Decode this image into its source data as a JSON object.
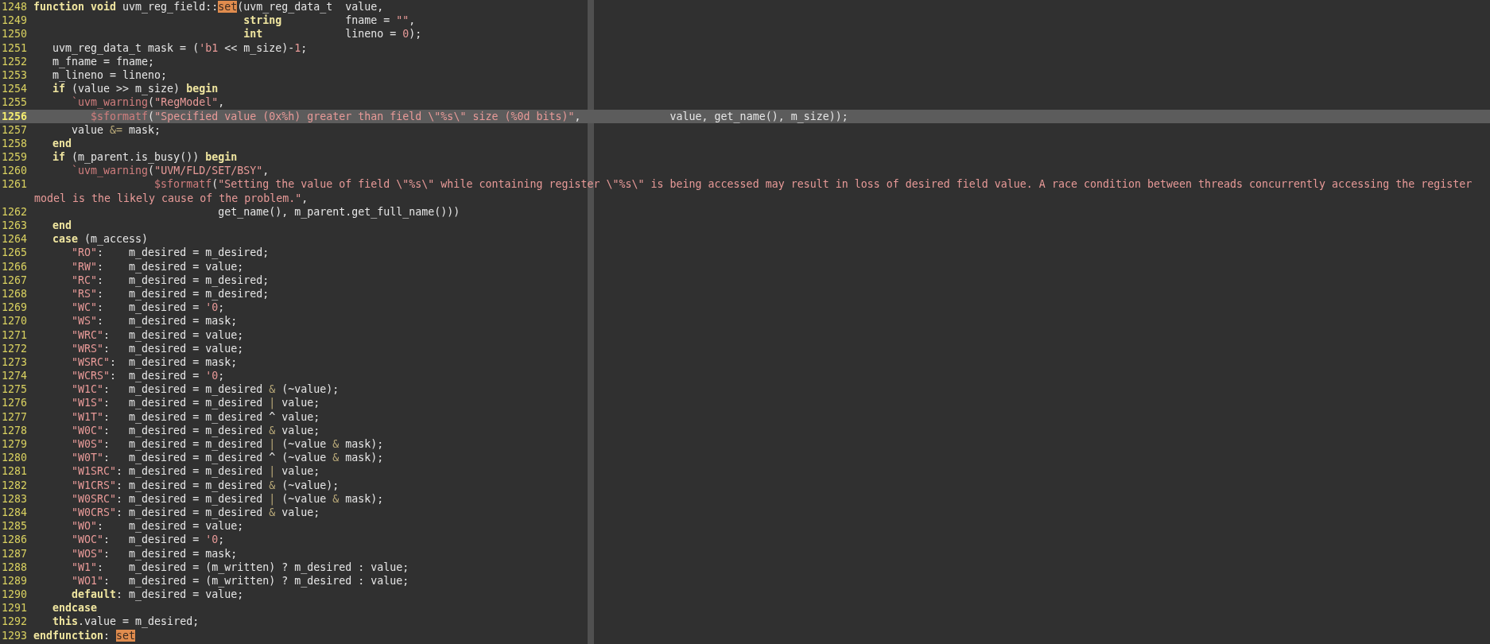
{
  "editor": {
    "lines": [
      {
        "kind": "code",
        "number": "1248",
        "current": false,
        "tokens": [
          {
            "kind": "keyword",
            "text": "function void"
          },
          {
            "kind": "plain",
            "text": " uvm_reg_field::"
          },
          {
            "kind": "match",
            "text": "set"
          },
          {
            "kind": "plain",
            "text": "(uvm_reg_data_t  value,"
          }
        ]
      },
      {
        "kind": "code",
        "number": "1249",
        "current": false,
        "tokens": [
          {
            "kind": "keyword",
            "text": "                                 string"
          },
          {
            "kind": "plain",
            "text": "          fname = "
          },
          {
            "kind": "string",
            "text": "\"\""
          },
          {
            "kind": "plain",
            "text": ","
          }
        ]
      },
      {
        "kind": "code",
        "number": "1250",
        "current": false,
        "tokens": [
          {
            "kind": "keyword",
            "text": "                                 int"
          },
          {
            "kind": "plain",
            "text": "             lineno = "
          },
          {
            "kind": "number",
            "text": "0"
          },
          {
            "kind": "plain",
            "text": ");"
          }
        ]
      },
      {
        "kind": "code",
        "number": "1251",
        "current": false,
        "tokens": [
          {
            "kind": "plain",
            "text": "   uvm_reg_data_t mask = ("
          },
          {
            "kind": "number",
            "text": "'b1"
          },
          {
            "kind": "plain",
            "text": " << m_size)-"
          },
          {
            "kind": "number",
            "text": "1"
          },
          {
            "kind": "plain",
            "text": ";"
          }
        ]
      },
      {
        "kind": "code",
        "number": "1252",
        "current": false,
        "tokens": [
          {
            "kind": "plain",
            "text": "   m_fname = fname;"
          }
        ]
      },
      {
        "kind": "code",
        "number": "1253",
        "current": false,
        "tokens": [
          {
            "kind": "plain",
            "text": "   m_lineno = lineno;"
          }
        ]
      },
      {
        "kind": "code",
        "number": "1254",
        "current": false,
        "tokens": [
          {
            "kind": "keyword",
            "text": "   if"
          },
          {
            "kind": "plain",
            "text": " (value >> m_size) "
          },
          {
            "kind": "keyword",
            "text": "begin"
          }
        ]
      },
      {
        "kind": "code",
        "number": "1255",
        "current": false,
        "tokens": [
          {
            "kind": "macro",
            "text": "      `uvm_warning"
          },
          {
            "kind": "plain",
            "text": "("
          },
          {
            "kind": "string",
            "text": "\"RegModel\""
          },
          {
            "kind": "plain",
            "text": ","
          }
        ]
      },
      {
        "kind": "code",
        "number": "1256",
        "current": true,
        "tokens": [
          {
            "kind": "macro",
            "text": "         $sformatf"
          },
          {
            "kind": "plain",
            "text": "("
          },
          {
            "kind": "string",
            "text": "\"Specified value (0x%h) greater than field \\\"%s\\\" size (%0d bits)\""
          },
          {
            "kind": "plain",
            "text": ",              value, get_name(), m_size));"
          }
        ]
      },
      {
        "kind": "code",
        "number": "1257",
        "current": false,
        "tokens": [
          {
            "kind": "plain",
            "text": "      value "
          },
          {
            "kind": "operator",
            "text": "&="
          },
          {
            "kind": "plain",
            "text": " mask;"
          }
        ]
      },
      {
        "kind": "code",
        "number": "1258",
        "current": false,
        "tokens": [
          {
            "kind": "keyword",
            "text": "   end"
          }
        ]
      },
      {
        "kind": "code",
        "number": "1259",
        "current": false,
        "tokens": [
          {
            "kind": "keyword",
            "text": "   if"
          },
          {
            "kind": "plain",
            "text": " (m_parent.is_busy()) "
          },
          {
            "kind": "keyword",
            "text": "begin"
          }
        ]
      },
      {
        "kind": "code",
        "number": "1260",
        "current": false,
        "tokens": [
          {
            "kind": "macro",
            "text": "      `uvm_warning"
          },
          {
            "kind": "plain",
            "text": "("
          },
          {
            "kind": "string",
            "text": "\"UVM/FLD/SET/BSY\""
          },
          {
            "kind": "plain",
            "text": ","
          }
        ]
      },
      {
        "kind": "code",
        "number": "1261",
        "current": false,
        "tokens": [
          {
            "kind": "macro",
            "text": "                   $sformatf"
          },
          {
            "kind": "plain",
            "text": "("
          },
          {
            "kind": "string",
            "text": "\"Setting the value of field \\\"%s\\\" while containing register \\\"%s\\\" is being accessed may result in loss of desired field value. A race condition between threads concurrently accessing the register"
          }
        ]
      },
      {
        "kind": "wrap",
        "tokens": [
          {
            "kind": "string",
            "text": "model is the likely cause of the problem.\""
          },
          {
            "kind": "plain",
            "text": ","
          }
        ]
      },
      {
        "kind": "code",
        "number": "1262",
        "current": false,
        "tokens": [
          {
            "kind": "plain",
            "text": "                             get_name(), m_parent.get_full_name()))"
          }
        ]
      },
      {
        "kind": "code",
        "number": "1263",
        "current": false,
        "tokens": [
          {
            "kind": "keyword",
            "text": "   end"
          }
        ]
      },
      {
        "kind": "code",
        "number": "1264",
        "current": false,
        "tokens": [
          {
            "kind": "keyword",
            "text": "   case"
          },
          {
            "kind": "plain",
            "text": " (m_access)"
          }
        ]
      },
      {
        "kind": "code",
        "number": "1265",
        "current": false,
        "tokens": [
          {
            "kind": "string",
            "text": "      \"RO\""
          },
          {
            "kind": "plain",
            "text": ":    m_desired = m_desired;"
          }
        ]
      },
      {
        "kind": "code",
        "number": "1266",
        "current": false,
        "tokens": [
          {
            "kind": "string",
            "text": "      \"RW\""
          },
          {
            "kind": "plain",
            "text": ":    m_desired = value;"
          }
        ]
      },
      {
        "kind": "code",
        "number": "1267",
        "current": false,
        "tokens": [
          {
            "kind": "string",
            "text": "      \"RC\""
          },
          {
            "kind": "plain",
            "text": ":    m_desired = m_desired;"
          }
        ]
      },
      {
        "kind": "code",
        "number": "1268",
        "current": false,
        "tokens": [
          {
            "kind": "string",
            "text": "      \"RS\""
          },
          {
            "kind": "plain",
            "text": ":    m_desired = m_desired;"
          }
        ]
      },
      {
        "kind": "code",
        "number": "1269",
        "current": false,
        "tokens": [
          {
            "kind": "string",
            "text": "      \"WC\""
          },
          {
            "kind": "plain",
            "text": ":    m_desired = "
          },
          {
            "kind": "number",
            "text": "'0"
          },
          {
            "kind": "plain",
            "text": ";"
          }
        ]
      },
      {
        "kind": "code",
        "number": "1270",
        "current": false,
        "tokens": [
          {
            "kind": "string",
            "text": "      \"WS\""
          },
          {
            "kind": "plain",
            "text": ":    m_desired = mask;"
          }
        ]
      },
      {
        "kind": "code",
        "number": "1271",
        "current": false,
        "tokens": [
          {
            "kind": "string",
            "text": "      \"WRC\""
          },
          {
            "kind": "plain",
            "text": ":   m_desired = value;"
          }
        ]
      },
      {
        "kind": "code",
        "number": "1272",
        "current": false,
        "tokens": [
          {
            "kind": "string",
            "text": "      \"WRS\""
          },
          {
            "kind": "plain",
            "text": ":   m_desired = value;"
          }
        ]
      },
      {
        "kind": "code",
        "number": "1273",
        "current": false,
        "tokens": [
          {
            "kind": "string",
            "text": "      \"WSRC\""
          },
          {
            "kind": "plain",
            "text": ":  m_desired = mask;"
          }
        ]
      },
      {
        "kind": "code",
        "number": "1274",
        "current": false,
        "tokens": [
          {
            "kind": "string",
            "text": "      \"WCRS\""
          },
          {
            "kind": "plain",
            "text": ":  m_desired = "
          },
          {
            "kind": "number",
            "text": "'0"
          },
          {
            "kind": "plain",
            "text": ";"
          }
        ]
      },
      {
        "kind": "code",
        "number": "1275",
        "current": false,
        "tokens": [
          {
            "kind": "string",
            "text": "      \"W1C\""
          },
          {
            "kind": "plain",
            "text": ":   m_desired = m_desired "
          },
          {
            "kind": "operator",
            "text": "&"
          },
          {
            "kind": "plain",
            "text": " (~value);"
          }
        ]
      },
      {
        "kind": "code",
        "number": "1276",
        "current": false,
        "tokens": [
          {
            "kind": "string",
            "text": "      \"W1S\""
          },
          {
            "kind": "plain",
            "text": ":   m_desired = m_desired "
          },
          {
            "kind": "operator",
            "text": "|"
          },
          {
            "kind": "plain",
            "text": " value;"
          }
        ]
      },
      {
        "kind": "code",
        "number": "1277",
        "current": false,
        "tokens": [
          {
            "kind": "string",
            "text": "      \"W1T\""
          },
          {
            "kind": "plain",
            "text": ":   m_desired = m_desired ^ value;"
          }
        ]
      },
      {
        "kind": "code",
        "number": "1278",
        "current": false,
        "tokens": [
          {
            "kind": "string",
            "text": "      \"W0C\""
          },
          {
            "kind": "plain",
            "text": ":   m_desired = m_desired "
          },
          {
            "kind": "operator",
            "text": "&"
          },
          {
            "kind": "plain",
            "text": " value;"
          }
        ]
      },
      {
        "kind": "code",
        "number": "1279",
        "current": false,
        "tokens": [
          {
            "kind": "string",
            "text": "      \"W0S\""
          },
          {
            "kind": "plain",
            "text": ":   m_desired = m_desired "
          },
          {
            "kind": "operator",
            "text": "|"
          },
          {
            "kind": "plain",
            "text": " (~value "
          },
          {
            "kind": "operator",
            "text": "&"
          },
          {
            "kind": "plain",
            "text": " mask);"
          }
        ]
      },
      {
        "kind": "code",
        "number": "1280",
        "current": false,
        "tokens": [
          {
            "kind": "string",
            "text": "      \"W0T\""
          },
          {
            "kind": "plain",
            "text": ":   m_desired = m_desired ^ (~value "
          },
          {
            "kind": "operator",
            "text": "&"
          },
          {
            "kind": "plain",
            "text": " mask);"
          }
        ]
      },
      {
        "kind": "code",
        "number": "1281",
        "current": false,
        "tokens": [
          {
            "kind": "string",
            "text": "      \"W1SRC\""
          },
          {
            "kind": "plain",
            "text": ": m_desired = m_desired "
          },
          {
            "kind": "operator",
            "text": "|"
          },
          {
            "kind": "plain",
            "text": " value;"
          }
        ]
      },
      {
        "kind": "code",
        "number": "1282",
        "current": false,
        "tokens": [
          {
            "kind": "string",
            "text": "      \"W1CRS\""
          },
          {
            "kind": "plain",
            "text": ": m_desired = m_desired "
          },
          {
            "kind": "operator",
            "text": "&"
          },
          {
            "kind": "plain",
            "text": " (~value);"
          }
        ]
      },
      {
        "kind": "code",
        "number": "1283",
        "current": false,
        "tokens": [
          {
            "kind": "string",
            "text": "      \"W0SRC\""
          },
          {
            "kind": "plain",
            "text": ": m_desired = m_desired "
          },
          {
            "kind": "operator",
            "text": "|"
          },
          {
            "kind": "plain",
            "text": " (~value "
          },
          {
            "kind": "operator",
            "text": "&"
          },
          {
            "kind": "plain",
            "text": " mask);"
          }
        ]
      },
      {
        "kind": "code",
        "number": "1284",
        "current": false,
        "tokens": [
          {
            "kind": "string",
            "text": "      \"W0CRS\""
          },
          {
            "kind": "plain",
            "text": ": m_desired = m_desired "
          },
          {
            "kind": "operator",
            "text": "&"
          },
          {
            "kind": "plain",
            "text": " value;"
          }
        ]
      },
      {
        "kind": "code",
        "number": "1285",
        "current": false,
        "tokens": [
          {
            "kind": "string",
            "text": "      \"WO\""
          },
          {
            "kind": "plain",
            "text": ":    m_desired = value;"
          }
        ]
      },
      {
        "kind": "code",
        "number": "1286",
        "current": false,
        "tokens": [
          {
            "kind": "string",
            "text": "      \"WOC\""
          },
          {
            "kind": "plain",
            "text": ":   m_desired = "
          },
          {
            "kind": "number",
            "text": "'0"
          },
          {
            "kind": "plain",
            "text": ";"
          }
        ]
      },
      {
        "kind": "code",
        "number": "1287",
        "current": false,
        "tokens": [
          {
            "kind": "string",
            "text": "      \"WOS\""
          },
          {
            "kind": "plain",
            "text": ":   m_desired = mask;"
          }
        ]
      },
      {
        "kind": "code",
        "number": "1288",
        "current": false,
        "tokens": [
          {
            "kind": "string",
            "text": "      \"W1\""
          },
          {
            "kind": "plain",
            "text": ":    m_desired = (m_written) ? m_desired : value;"
          }
        ]
      },
      {
        "kind": "code",
        "number": "1289",
        "current": false,
        "tokens": [
          {
            "kind": "string",
            "text": "      \"WO1\""
          },
          {
            "kind": "plain",
            "text": ":   m_desired = (m_written) ? m_desired : value;"
          }
        ]
      },
      {
        "kind": "code",
        "number": "1290",
        "current": false,
        "tokens": [
          {
            "kind": "keyword",
            "text": "      default"
          },
          {
            "kind": "plain",
            "text": ": m_desired = value;"
          }
        ]
      },
      {
        "kind": "code",
        "number": "1291",
        "current": false,
        "tokens": [
          {
            "kind": "keyword",
            "text": "   endcase"
          }
        ]
      },
      {
        "kind": "code",
        "number": "1292",
        "current": false,
        "tokens": [
          {
            "kind": "keyword",
            "text": "   this"
          },
          {
            "kind": "plain",
            "text": ".value = m_desired;"
          }
        ]
      },
      {
        "kind": "code",
        "number": "1293",
        "current": false,
        "tokens": [
          {
            "kind": "keyword",
            "text": "endfunction"
          },
          {
            "kind": "plain",
            "text": ": "
          },
          {
            "kind": "match",
            "text": "set"
          }
        ]
      }
    ]
  }
}
